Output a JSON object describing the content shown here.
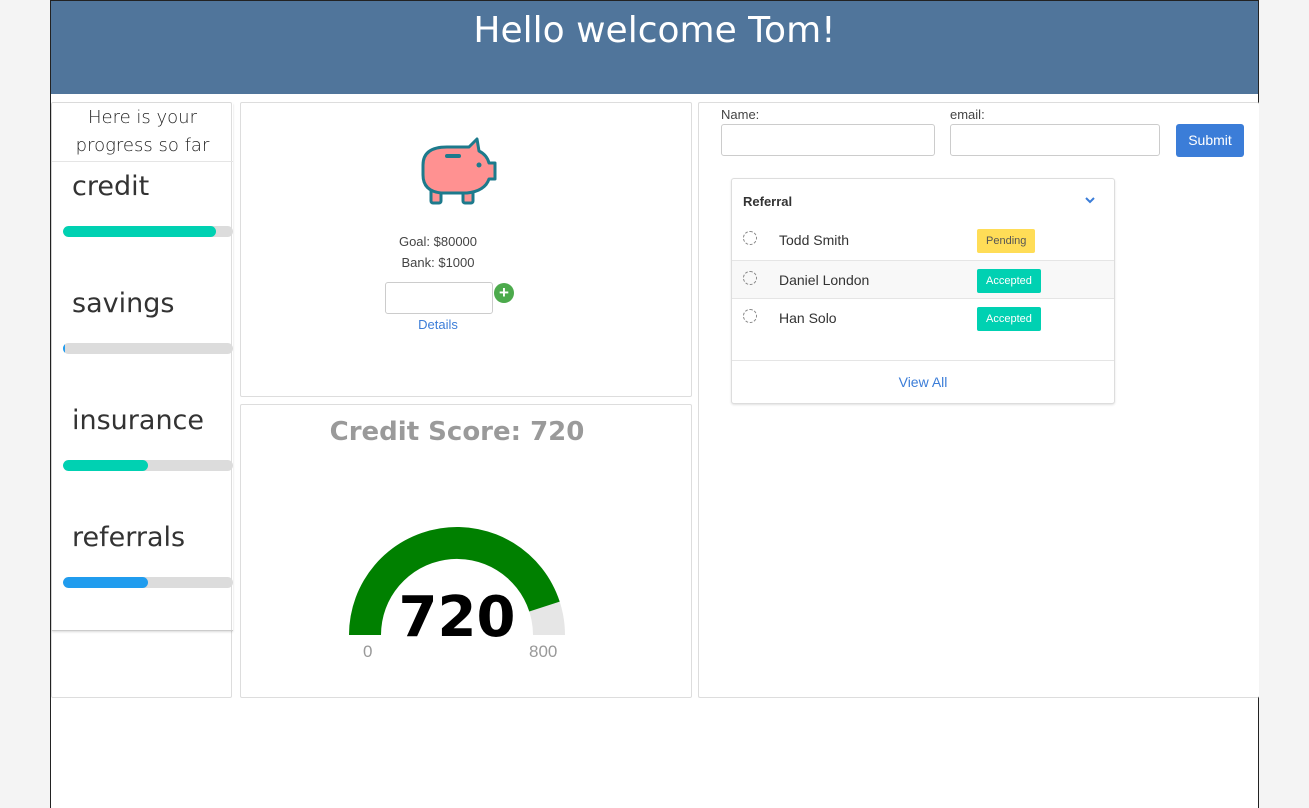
{
  "header": {
    "title": "Hello welcome Tom!"
  },
  "progress": {
    "heading": "Here is your progress so far",
    "items": [
      {
        "label": "credit",
        "percent": 90,
        "color": "#00d1b2"
      },
      {
        "label": "savings",
        "percent": 1,
        "color": "#209cee"
      },
      {
        "label": "insurance",
        "percent": 50,
        "color": "#00d1b2"
      },
      {
        "label": "referrals",
        "percent": 50,
        "color": "#209cee"
      }
    ]
  },
  "goal": {
    "icon": "piggy-bank-icon",
    "goal_text": "Goal: $80000",
    "bank_text": "Bank: $1000",
    "add_icon": "plus-circle-icon",
    "details_label": "Details"
  },
  "credit": {
    "title": "Credit Score: 720",
    "value": "720",
    "min": "0",
    "max": "800",
    "score": 720,
    "max_score": 800,
    "fill_color": "#008000"
  },
  "form": {
    "name_label": "Name:",
    "email_label": "email:",
    "submit_label": "Submit"
  },
  "referral": {
    "title": "Referral",
    "rows": [
      {
        "name": "Todd Smith",
        "status": "Pending"
      },
      {
        "name": "Daniel London",
        "status": "Accepted"
      },
      {
        "name": "Han Solo",
        "status": "Accepted"
      }
    ],
    "view_all": "View All"
  }
}
